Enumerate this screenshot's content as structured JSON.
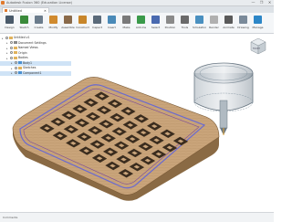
{
  "window": {
    "title": "Autodesk Fusion 360 (Education License)",
    "controls": [
      "—",
      "❐",
      "✕"
    ]
  },
  "tabs": [
    {
      "label": "Untitled",
      "close": "✕"
    }
  ],
  "toolbar": {
    "items": [
      {
        "label": "Design",
        "icon": "design-icon",
        "color": "#4a5a6a"
      },
      {
        "label": "Sketch",
        "icon": "sketch-icon",
        "color": "#3a8a3a"
      },
      {
        "label": "Create",
        "icon": "create-icon",
        "color": "#6b7c8c"
      },
      {
        "label": "Modify",
        "icon": "modify-icon",
        "color": "#d08a2e"
      },
      {
        "label": "Assemble",
        "icon": "assemble-icon",
        "color": "#8a6a4a"
      },
      {
        "label": "Construct",
        "icon": "construct-icon",
        "color": "#c8862a"
      },
      {
        "label": "Inspect",
        "icon": "inspect-icon",
        "color": "#5a6a7a"
      },
      {
        "label": "Insert",
        "icon": "insert-icon",
        "color": "#4a8ab8"
      },
      {
        "label": "Make",
        "icon": "make-icon",
        "color": "#7a7a7a"
      },
      {
        "label": "Add-Ins",
        "icon": "addins-icon",
        "color": "#3a9a4a"
      },
      {
        "label": "Select",
        "icon": "select-icon",
        "color": "#4a6ab0"
      },
      {
        "label": "Position",
        "icon": "position-icon",
        "color": "#8a8a8a"
      },
      {
        "label": "Tools",
        "icon": "tools-icon",
        "color": "#6a6a6a"
      },
      {
        "label": "Simulation",
        "icon": "simulation-icon",
        "color": "#4a90c0"
      },
      {
        "label": "Render",
        "icon": "render-icon",
        "color": "#b0b0b0"
      },
      {
        "label": "Animate",
        "icon": "animate-icon",
        "color": "#5a5a5a"
      },
      {
        "label": "Drawing",
        "icon": "drawing-icon",
        "color": "#7a8a9a"
      },
      {
        "label": "Manage",
        "icon": "manage-icon",
        "color": "#2c86c7",
        "active": true
      }
    ]
  },
  "browser": {
    "rows": [
      {
        "label": "Untitled v1",
        "level": 0,
        "icon": "folder-icon"
      },
      {
        "label": "Document Settings",
        "level": 1,
        "icon": "gear-icon"
      },
      {
        "label": "Named Views",
        "level": 1,
        "icon": "folder-icon"
      },
      {
        "label": "Origin",
        "level": 1,
        "icon": "folder-icon"
      },
      {
        "label": "Bodies",
        "level": 1,
        "icon": "folder-icon"
      },
      {
        "label": "Body1",
        "level": 2,
        "icon": "body-icon",
        "selected": true
      },
      {
        "label": "Sketches",
        "level": 2,
        "icon": "folder-icon"
      },
      {
        "label": "Component1",
        "level": 2,
        "icon": "component-icon",
        "selected": true
      }
    ]
  },
  "viewcube": {
    "face": "FRONT"
  },
  "status": {
    "text": "Comments"
  },
  "colors": {
    "plate_top": "#c9a47a",
    "plate_edge": "#8a6a44",
    "holes": "#3a2c1e",
    "toolpath": "#6a6ad0",
    "cylinder": "#8a9aa8"
  }
}
